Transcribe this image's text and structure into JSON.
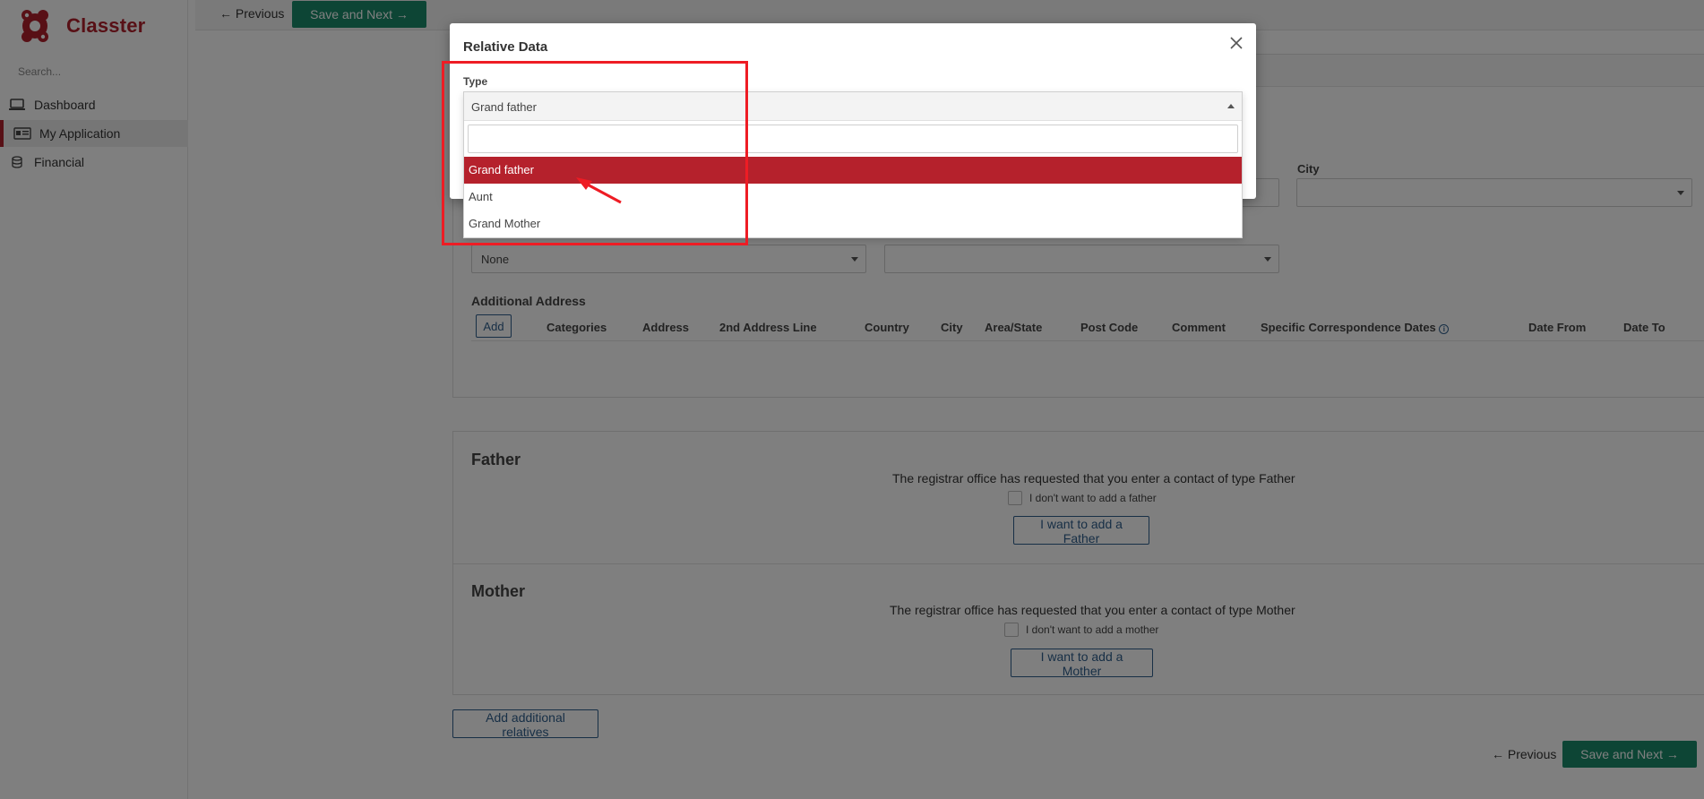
{
  "app": {
    "name": "Classter"
  },
  "sidebar": {
    "search_placeholder": "Search...",
    "items": [
      {
        "label": "Dashboard",
        "icon": "laptop-icon"
      },
      {
        "label": "My Application",
        "icon": "id-card-icon",
        "active": true
      },
      {
        "label": "Financial",
        "icon": "coins-icon"
      }
    ]
  },
  "toolbar": {
    "previous_label": "Previous",
    "save_next_label": "Save and Next"
  },
  "address_form": {
    "city_label": "City",
    "city_value": "",
    "select_value_none": "None",
    "select_value_empty": "",
    "additional_address_label": "Additional Address",
    "add_label": "Add",
    "columns": [
      "Categories",
      "Address",
      "2nd Address Line",
      "Country",
      "City",
      "Area/State",
      "Post Code",
      "Comment",
      "Specific Correspondence Dates",
      "Date From",
      "Date To"
    ]
  },
  "father": {
    "title": "Father",
    "message": "The registrar office has requested that you enter a contact of type Father",
    "checkbox_label": "I don't want to add a father",
    "button_label": "I want to add a Father"
  },
  "mother": {
    "title": "Mother",
    "message": "The registrar office has requested that you enter a contact of type Mother",
    "checkbox_label": "I don't want to add a mother",
    "button_label": "I want to add a Mother"
  },
  "footer": {
    "add_relatives_label": "Add additional relatives",
    "previous_label": "Previous",
    "save_next_label": "Save and Next"
  },
  "modal": {
    "title": "Relative Data",
    "type_label": "Type",
    "selected_value": "Grand father",
    "search_value": "",
    "options": [
      "Grand father",
      "Aunt",
      "Grand Mother"
    ],
    "highlighted_index": 0
  },
  "colors": {
    "brand_red": "#b0212c",
    "primary_green": "#1a8a6b",
    "link_blue": "#2f5e8c",
    "annotation_red": "#ee1c24"
  }
}
